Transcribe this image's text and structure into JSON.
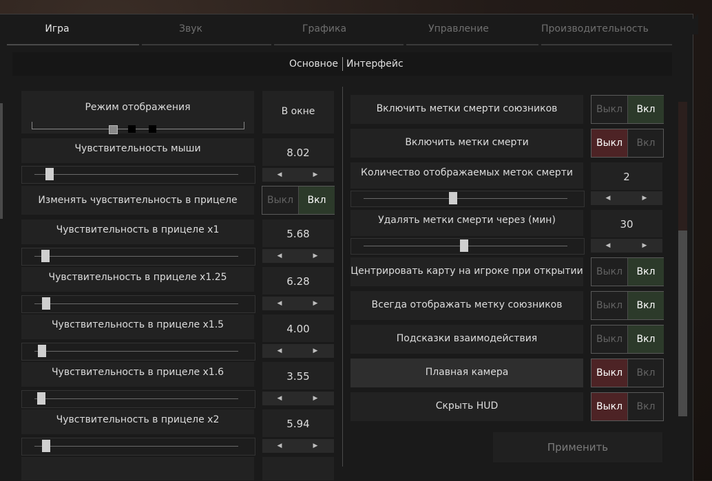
{
  "tabs": [
    "Игра",
    "Звук",
    "Графика",
    "Управление",
    "Производительность"
  ],
  "subtabs": [
    "Основное",
    "Интерфейс"
  ],
  "display_mode": {
    "label": "Режим отображения",
    "value": "В окне"
  },
  "toggle_labels": {
    "off": "Выкл",
    "on": "Вкл"
  },
  "left": {
    "mouse_sens": {
      "label": "Чувствительность мыши",
      "value": "8.02"
    },
    "change_scope_sens": {
      "label": "Изменять чувствительность в прицеле"
    },
    "scope_x1": {
      "label": "Чувствительность в прицеле x1",
      "value": "5.68"
    },
    "scope_x125": {
      "label": "Чувствительность в прицеле x1.25",
      "value": "6.28"
    },
    "scope_x15": {
      "label": "Чувствительность в прицеле x1.5",
      "value": "4.00"
    },
    "scope_x16": {
      "label": "Чувствительность в прицеле x1.6",
      "value": "3.55"
    },
    "scope_x2": {
      "label": "Чувствительность в прицеле x2",
      "value": "5.94"
    }
  },
  "right": {
    "ally_death_marks": {
      "label": "Включить метки смерти союзников"
    },
    "death_marks": {
      "label": "Включить метки смерти"
    },
    "death_marks_count": {
      "label": "Количество отображаемых меток смерти",
      "value": "2"
    },
    "death_marks_remove": {
      "label": "Удалять метки смерти через (мин)",
      "value": "30"
    },
    "center_map": {
      "label": "Центрировать карту на игроке при открытии"
    },
    "ally_mark": {
      "label": "Всегда отображать метку союзников"
    },
    "hints": {
      "label": "Подсказки взаимодействия"
    },
    "smooth_camera": {
      "label": "Плавная камера"
    },
    "hide_hud": {
      "label": "Скрыть HUD"
    }
  },
  "apply": "Применить"
}
